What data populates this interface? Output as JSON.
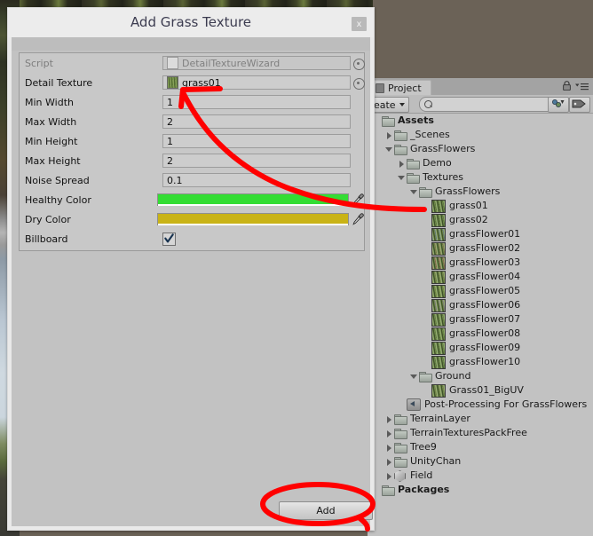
{
  "window": {
    "title": "Add Grass Texture",
    "close_label": "x"
  },
  "inspector": {
    "rows": [
      {
        "label": "Script",
        "value": "DetailTextureWizard",
        "type": "object",
        "dim": true,
        "icon": "script-icon"
      },
      {
        "label": "Detail Texture",
        "value": "grass01",
        "type": "object",
        "dim": false,
        "icon": "texture-thumbnail"
      },
      {
        "label": "Min Width",
        "value": "1",
        "type": "text"
      },
      {
        "label": "Max Width",
        "value": "2",
        "type": "text"
      },
      {
        "label": "Min Height",
        "value": "1",
        "type": "text"
      },
      {
        "label": "Max Height",
        "value": "2",
        "type": "text"
      },
      {
        "label": "Noise Spread",
        "value": "0.1",
        "type": "text"
      },
      {
        "label": "Healthy Color",
        "value": "#33DD33",
        "type": "color"
      },
      {
        "label": "Dry Color",
        "value": "#C9B316",
        "type": "color"
      },
      {
        "label": "Billboard",
        "value": "true",
        "type": "checkbox"
      }
    ]
  },
  "footer": {
    "add_label": "Add"
  },
  "project": {
    "tab_label": "Project",
    "create_label": "Create",
    "search_placeholder": "",
    "tree": [
      {
        "label": "Assets",
        "indent": 0,
        "arrow": "none",
        "icon": "folder",
        "bold": true
      },
      {
        "label": "_Scenes",
        "indent": 1,
        "arrow": "closed",
        "icon": "folder",
        "bold": false
      },
      {
        "label": "GrassFlowers",
        "indent": 1,
        "arrow": "open",
        "icon": "folder",
        "bold": false
      },
      {
        "label": "Demo",
        "indent": 2,
        "arrow": "closed",
        "icon": "folder",
        "bold": false
      },
      {
        "label": "Textures",
        "indent": 2,
        "arrow": "open",
        "icon": "folder",
        "bold": false
      },
      {
        "label": "GrassFlowers",
        "indent": 3,
        "arrow": "open",
        "icon": "folder",
        "bold": false
      },
      {
        "label": "grass01",
        "indent": 4,
        "arrow": "none",
        "icon": "texture",
        "bold": false,
        "thumb": "#3f5a24"
      },
      {
        "label": "grass02",
        "indent": 4,
        "arrow": "none",
        "icon": "texture",
        "bold": false,
        "thumb": "#3d5a28"
      },
      {
        "label": "grassFlower01",
        "indent": 4,
        "arrow": "none",
        "icon": "texture",
        "bold": false,
        "thumb": "#4a5f7a"
      },
      {
        "label": "grassFlower02",
        "indent": 4,
        "arrow": "none",
        "icon": "texture",
        "bold": false,
        "thumb": "#6a5a3a"
      },
      {
        "label": "grassFlower03",
        "indent": 4,
        "arrow": "none",
        "icon": "texture",
        "bold": false,
        "thumb": "#7a4040"
      },
      {
        "label": "grassFlower04",
        "indent": 4,
        "arrow": "none",
        "icon": "texture",
        "bold": false,
        "thumb": "#5d6a35"
      },
      {
        "label": "grassFlower05",
        "indent": 4,
        "arrow": "none",
        "icon": "texture",
        "bold": false,
        "thumb": "#5c7230"
      },
      {
        "label": "grassFlower06",
        "indent": 4,
        "arrow": "none",
        "icon": "texture",
        "bold": false,
        "thumb": "#6b5f7a"
      },
      {
        "label": "grassFlower07",
        "indent": 4,
        "arrow": "none",
        "icon": "texture",
        "bold": false,
        "thumb": "#4d6a35"
      },
      {
        "label": "grassFlower08",
        "indent": 4,
        "arrow": "none",
        "icon": "texture",
        "bold": false,
        "thumb": "#48662e"
      },
      {
        "label": "grassFlower09",
        "indent": 4,
        "arrow": "none",
        "icon": "texture",
        "bold": false,
        "thumb": "#50703a"
      },
      {
        "label": "grassFlower10",
        "indent": 4,
        "arrow": "none",
        "icon": "texture",
        "bold": false,
        "thumb": "#3f5c2c"
      },
      {
        "label": "Ground",
        "indent": 3,
        "arrow": "open",
        "icon": "folder",
        "bold": false
      },
      {
        "label": "Grass01_BigUV",
        "indent": 4,
        "arrow": "none",
        "icon": "texture",
        "bold": false,
        "thumb": "#5e6b3c"
      },
      {
        "label": "Post-Processing For GrassFlowers",
        "indent": 2,
        "arrow": "none",
        "icon": "ppv",
        "bold": false
      },
      {
        "label": "TerrainLayer",
        "indent": 1,
        "arrow": "closed",
        "icon": "folder",
        "bold": false
      },
      {
        "label": "TerrainTexturesPackFree",
        "indent": 1,
        "arrow": "closed",
        "icon": "folder",
        "bold": false
      },
      {
        "label": "Tree9",
        "indent": 1,
        "arrow": "closed",
        "icon": "folder",
        "bold": false
      },
      {
        "label": "UnityChan",
        "indent": 1,
        "arrow": "closed",
        "icon": "folder",
        "bold": false
      },
      {
        "label": "Field",
        "indent": 1,
        "arrow": "closed",
        "icon": "prefab",
        "bold": false
      },
      {
        "label": "Packages",
        "indent": 0,
        "arrow": "none",
        "icon": "folder",
        "bold": true
      }
    ]
  },
  "annotations": {
    "color": "#FF0000",
    "arrow_note": "curved arrow from grass01 asset to Min/Max Width fields",
    "ellipse_note": "ellipse highlighting the Add button"
  }
}
